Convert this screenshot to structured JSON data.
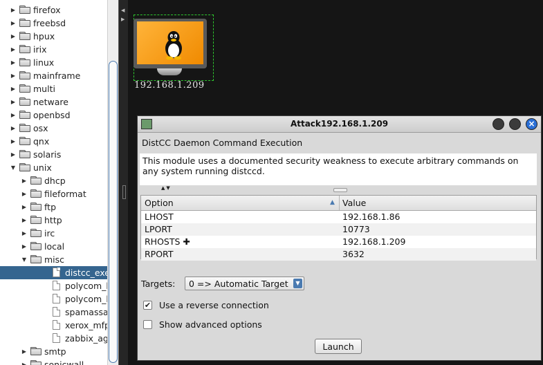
{
  "tree": {
    "selected": "distcc_exec",
    "items": [
      {
        "label": "firefox",
        "kind": "folder",
        "depth": 0,
        "expanded": false
      },
      {
        "label": "freebsd",
        "kind": "folder",
        "depth": 0,
        "expanded": false
      },
      {
        "label": "hpux",
        "kind": "folder",
        "depth": 0,
        "expanded": false
      },
      {
        "label": "irix",
        "kind": "folder",
        "depth": 0,
        "expanded": false
      },
      {
        "label": "linux",
        "kind": "folder",
        "depth": 0,
        "expanded": false
      },
      {
        "label": "mainframe",
        "kind": "folder",
        "depth": 0,
        "expanded": false
      },
      {
        "label": "multi",
        "kind": "folder",
        "depth": 0,
        "expanded": false
      },
      {
        "label": "netware",
        "kind": "folder",
        "depth": 0,
        "expanded": false
      },
      {
        "label": "openbsd",
        "kind": "folder",
        "depth": 0,
        "expanded": false
      },
      {
        "label": "osx",
        "kind": "folder",
        "depth": 0,
        "expanded": false
      },
      {
        "label": "qnx",
        "kind": "folder",
        "depth": 0,
        "expanded": false
      },
      {
        "label": "solaris",
        "kind": "folder",
        "depth": 0,
        "expanded": false
      },
      {
        "label": "unix",
        "kind": "folder",
        "depth": 0,
        "expanded": true
      },
      {
        "label": "dhcp",
        "kind": "folder",
        "depth": 1,
        "expanded": false
      },
      {
        "label": "fileformat",
        "kind": "folder",
        "depth": 1,
        "expanded": false
      },
      {
        "label": "ftp",
        "kind": "folder",
        "depth": 1,
        "expanded": false
      },
      {
        "label": "http",
        "kind": "folder",
        "depth": 1,
        "expanded": false
      },
      {
        "label": "irc",
        "kind": "folder",
        "depth": 1,
        "expanded": false
      },
      {
        "label": "local",
        "kind": "folder",
        "depth": 1,
        "expanded": false
      },
      {
        "label": "misc",
        "kind": "folder",
        "depth": 1,
        "expanded": true
      },
      {
        "label": "distcc_exec",
        "kind": "file",
        "depth": 2
      },
      {
        "label": "polycom_hdx",
        "kind": "file",
        "depth": 2
      },
      {
        "label": "polycom_hdx",
        "kind": "file",
        "depth": 2
      },
      {
        "label": "spamassassin",
        "kind": "file",
        "depth": 2
      },
      {
        "label": "xerox_mfp",
        "kind": "file",
        "depth": 2
      },
      {
        "label": "zabbix_agent",
        "kind": "file",
        "depth": 2
      },
      {
        "label": "smtp",
        "kind": "folder",
        "depth": 1,
        "expanded": false
      },
      {
        "label": "sonicwall",
        "kind": "folder",
        "depth": 1,
        "expanded": false
      }
    ]
  },
  "host": {
    "ip": "192.168.1.209",
    "icon": "linux-penguin-icon"
  },
  "dialog": {
    "title": "Attack192.168.1.209",
    "module_name": "DistCC Daemon Command Execution",
    "description": "This module uses a documented security weakness to execute arbitrary commands on any system running distccd.",
    "table": {
      "headers": [
        "Option",
        "Value"
      ],
      "rows": [
        {
          "option": "LHOST",
          "value": "192.168.1.86",
          "required": false
        },
        {
          "option": "LPORT",
          "value": "10773",
          "required": false
        },
        {
          "option": "RHOSTS",
          "value": "192.168.1.209",
          "required": true
        },
        {
          "option": "RPORT",
          "value": "3632",
          "required": false
        }
      ]
    },
    "targets_label": "Targets:",
    "target_selected": "0 => Automatic Target",
    "reverse_label": "Use a reverse connection",
    "reverse_checked": true,
    "advanced_label": "Show advanced options",
    "advanced_checked": false,
    "launch_label": "Launch"
  },
  "colors": {
    "canvas_bg": "#151515",
    "selection": "#35658f",
    "accent": "#4a7ab0",
    "host_screen": "#f59a12",
    "host_selection_border": "#2ec82e",
    "close_button": "#2a6fd6"
  }
}
